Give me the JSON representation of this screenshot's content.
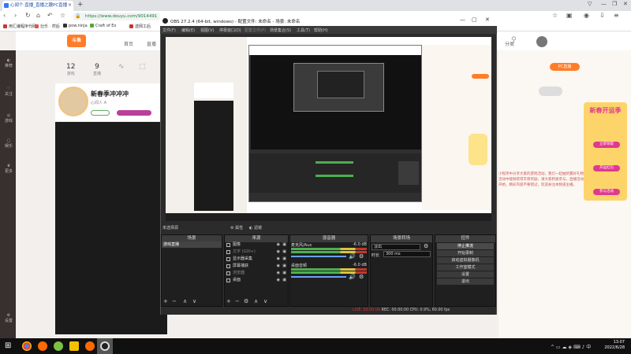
{
  "browser": {
    "tab_title": "心闻个·直播_直播之趣PC直播",
    "url": "https://www.douyu.com/9014491",
    "bookmarks": [
      "用汇编程序代码",
      "壮乐 · 然后",
      "pow.ninja",
      "Craft of Ex",
      "送网工后"
    ]
  },
  "douyu": {
    "logo": "斗鱼",
    "nav": [
      "首页",
      "直播",
      "分类"
    ],
    "stats": [
      {
        "value": "12",
        "label": "游戏"
      },
      {
        "value": "9",
        "label": "直播"
      }
    ],
    "streamer_name": "新春季冲冲冲",
    "streamer_sub": "心闻人 A",
    "pc_button": "PC直播",
    "promo_title": "新春开运季",
    "promo_buttons": [
      "立即领取",
      "开运红包",
      "参与活动"
    ],
    "right_text": "小程序中分享大家的游戏活动，我们一起抽奖赢好礼物，在活动中能够获得丰厚奖励，请大家积极参与，直播活动即将开始，精彩内容不要错过，欢迎关注本频道主播。",
    "left_icons": [
      "推荐",
      "关注",
      "游戏",
      "娱乐",
      "更多",
      "设置"
    ]
  },
  "obs": {
    "title": "OBS 27.2.4 (64-bit, windows) - 配置文件: 未命名 - 场景: 未命名",
    "menu": [
      "文件(F)",
      "编辑(E)",
      "视图(V)",
      "停靠窗口(D)",
      "配置文件(P)",
      "场景集合(S)",
      "工具(T)",
      "帮助(H)"
    ],
    "no_scene_selected": "未选择源",
    "scene_transition_buttons": [
      "属性",
      "滤镜"
    ],
    "docks": {
      "scenes": "场景",
      "sources": "来源",
      "mixer": "混音器",
      "transitions": "场景转场",
      "controls": "控件"
    },
    "scene_list": [
      "游戏直播"
    ],
    "sources": [
      "图像",
      "文字 (GDI+)",
      "显示器采集",
      "屏幕捕获",
      "浏览器",
      "桌面"
    ],
    "mixer": [
      {
        "name": "麦克风/Aux",
        "db": "-6.0 dB",
        "level": 0.8
      },
      {
        "name": "桌面音频",
        "db": "-6.0 dB",
        "level": 0.7
      }
    ],
    "transition": {
      "selected": "淡出",
      "duration_label": "时长",
      "duration": "300 ms"
    },
    "controls": [
      "停止推流",
      "开始录制",
      "启动虚拟摄像机",
      "工作室模式",
      "设置",
      "退出"
    ],
    "status": {
      "live": "LIVE: 00:00:00",
      "rec": "REC: 00:00:00",
      "cpu": "CPU: 0.9%, 60.00 fps",
      "dropped": "掉帧 0 (0.0%)"
    }
  },
  "taskbar": {
    "time": "13:07",
    "date": "2022/6/28"
  }
}
